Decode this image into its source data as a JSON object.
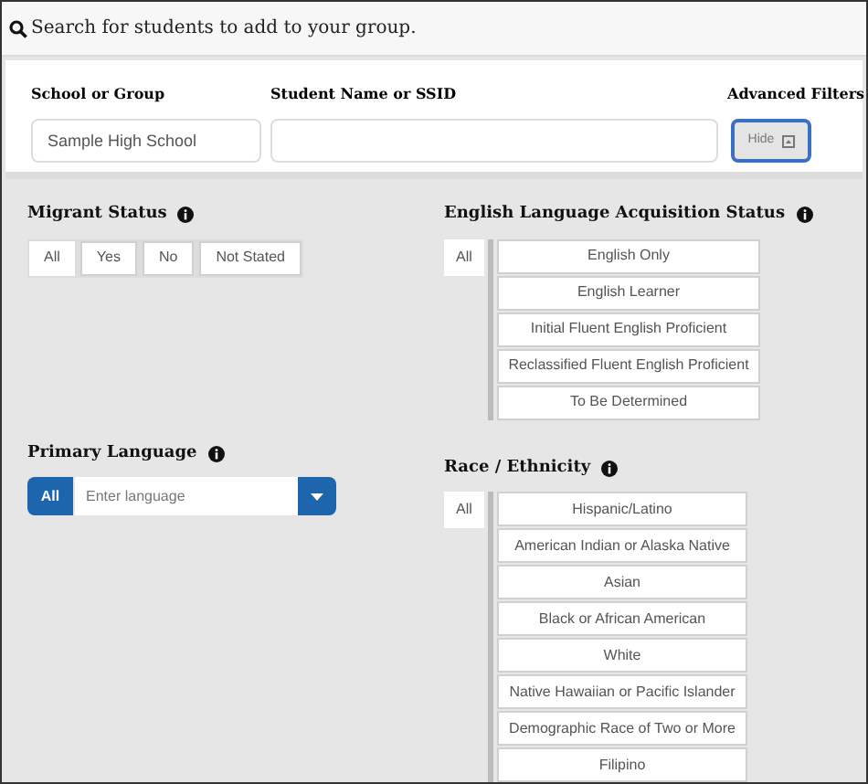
{
  "header": {
    "title": "Search for students to add to your group."
  },
  "search": {
    "school": {
      "label": "School or Group",
      "value": "Sample High School"
    },
    "student": {
      "label": "Student Name or SSID"
    },
    "advanced": {
      "label": "Advanced Filters",
      "button": "Hide"
    }
  },
  "filters": {
    "migrant": {
      "title": "Migrant Status",
      "options": [
        {
          "label": "All",
          "selected": true
        },
        {
          "label": "Yes",
          "selected": false
        },
        {
          "label": "No",
          "selected": false
        },
        {
          "label": "Not Stated",
          "selected": false
        }
      ]
    },
    "ela": {
      "title": "English Language Acquisition Status",
      "all": {
        "label": "All",
        "selected": true
      },
      "options": [
        {
          "label": "English Only",
          "selected": false
        },
        {
          "label": "English Learner",
          "selected": false
        },
        {
          "label": "Initial Fluent English Proficient",
          "selected": false
        },
        {
          "label": "Reclassified Fluent English Proficient",
          "selected": false
        },
        {
          "label": "To Be Determined",
          "selected": false
        }
      ]
    },
    "language": {
      "title": "Primary Language",
      "all": {
        "label": "All",
        "selected": true
      },
      "placeholder": "Enter language"
    },
    "race": {
      "title": "Race / Ethnicity",
      "all": {
        "label": "All",
        "selected": true
      },
      "options": [
        {
          "label": "Hispanic/Latino",
          "selected": false
        },
        {
          "label": "American Indian or Alaska Native",
          "selected": false
        },
        {
          "label": "Asian",
          "selected": false
        },
        {
          "label": "Black or African American",
          "selected": false
        },
        {
          "label": "White",
          "selected": false
        },
        {
          "label": "Native Hawaiian or Pacific Islander",
          "selected": false
        },
        {
          "label": "Demographic Race of Two or More",
          "selected": false
        },
        {
          "label": "Filipino",
          "selected": false
        }
      ]
    }
  }
}
